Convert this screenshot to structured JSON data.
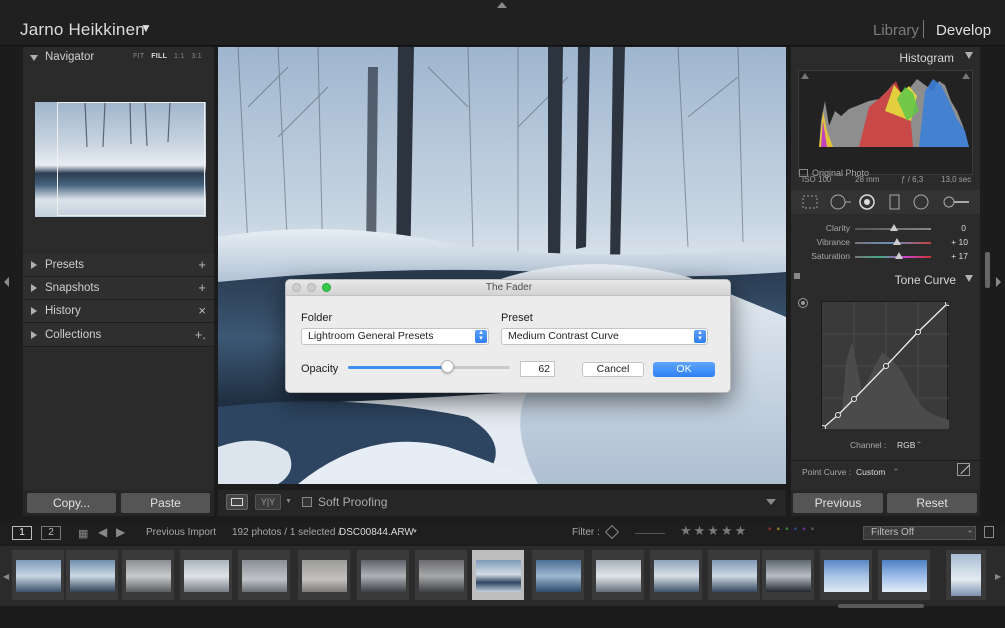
{
  "header": {
    "owner": "Jarno Heikkinen",
    "modules": [
      "Library",
      "Develop"
    ],
    "active_module": "Develop"
  },
  "left_panel": {
    "navigator": {
      "title": "Navigator",
      "options": [
        "FIT",
        "FILL",
        "1:1",
        "3:1"
      ],
      "selected_option": "FILL"
    },
    "sections": [
      {
        "label": "Presets",
        "action": "+"
      },
      {
        "label": "Snapshots",
        "action": "+"
      },
      {
        "label": "History",
        "action": "×"
      },
      {
        "label": "Collections",
        "action": "+."
      }
    ],
    "copy_label": "Copy...",
    "paste_label": "Paste"
  },
  "right_panel": {
    "histogram": {
      "title": "Histogram",
      "iso": "ISO 100",
      "focal": "28 mm",
      "aperture": "ƒ / 6,3",
      "shutter": "13,0 sec",
      "original_photo": "Original Photo"
    },
    "basic": [
      {
        "label": "Clarity",
        "value": "0",
        "level": 0.5
      },
      {
        "label": "Vibrance",
        "value": "+ 10",
        "level": 0.55
      },
      {
        "label": "Saturation",
        "value": "+ 17",
        "level": 0.58
      }
    ],
    "tone_curve": {
      "title": "Tone Curve",
      "channel_label": "Channel :",
      "channel": "RGB",
      "point_curve_label": "Point Curve :",
      "point_curve": "Custom"
    },
    "previous_label": "Previous",
    "reset_label": "Reset"
  },
  "toolbar": {
    "soft_proofing": "Soft Proofing"
  },
  "filmstrip_bar": {
    "page_1": "1",
    "page_2": "2",
    "source": "Previous Import",
    "count": "192 photos / 1 selected /",
    "filename": "DSC00844.ARW",
    "filter_label": "Filter :",
    "filter_value": "Filters Off"
  },
  "dialog": {
    "title": "The Fader",
    "folder_label": "Folder",
    "folder_value": "Lightroom General Presets",
    "preset_label": "Preset",
    "preset_value": "Medium Contrast Curve",
    "opacity_label": "Opacity",
    "opacity_value": "62",
    "cancel_label": "Cancel",
    "ok_label": "OK"
  },
  "colors": {
    "accent_blue": "#3d8ff5",
    "panel_bg": "#2b2b2b",
    "app_bg": "#1c1c1c"
  }
}
